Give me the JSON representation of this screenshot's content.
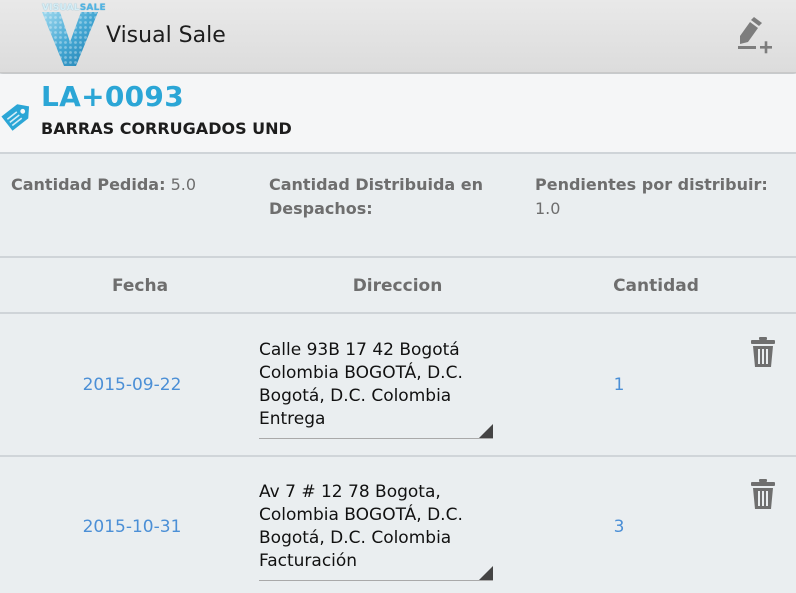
{
  "app": {
    "logo_text_a": "VISUAL",
    "logo_text_b": "SALE",
    "title": "Visual Sale",
    "add_icon": "edit-add-icon",
    "brand_color": "#2ba6d6"
  },
  "product": {
    "code": "LA+0093",
    "name": "BARRAS CORRUGADOS UND",
    "icon": "tag-icon"
  },
  "summary": {
    "cantidad_pedida_label": "Cantidad Pedida:",
    "cantidad_pedida_value": "5.0",
    "cantidad_distribuida_label": "Cantidad Distribuida en Despachos:",
    "pendientes_label": "Pendientes por distribuir:",
    "pendientes_value": "1.0"
  },
  "table": {
    "columns": [
      "Fecha",
      "Direccion",
      "Cantidad"
    ],
    "rows": [
      {
        "fecha": "2015-09-22",
        "direccion": "Calle 93B 17 42 Bogotá\nColombia BOGOTÁ, D.C.\nBogotá, D.C. Colombia\nEntrega",
        "cantidad": "1"
      },
      {
        "fecha": "2015-10-31",
        "direccion": "Av 7 # 12 78 Bogota,\nColombia BOGOTÁ, D.C.\nBogotá, D.C. Colombia\nFacturación",
        "cantidad": "3"
      }
    ],
    "delete_icon": "trash-icon",
    "link_color": "#4b8fd6"
  }
}
